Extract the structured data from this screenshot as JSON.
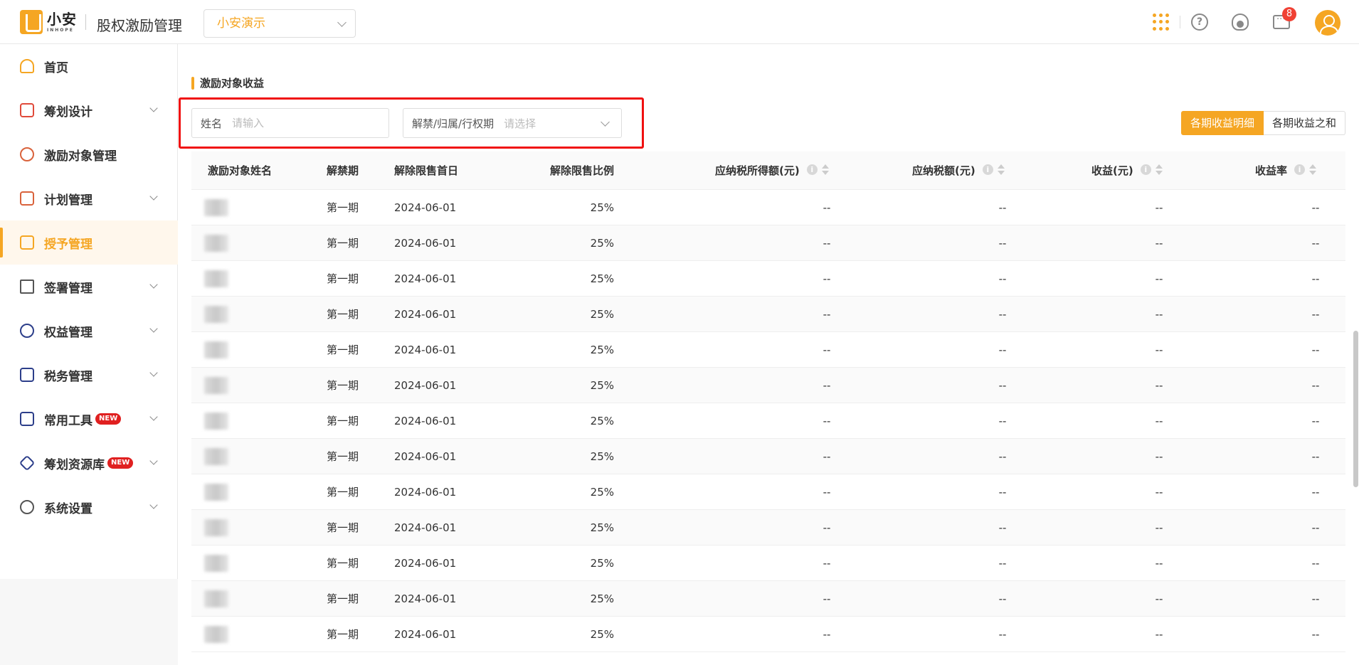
{
  "header": {
    "logo_cn": "小安",
    "logo_en": "INHOPE",
    "app_title": "股权激励管理",
    "org_select": "小安演示",
    "message_badge": "8",
    "accent_color": "#f5a623"
  },
  "sidebar": {
    "items": [
      {
        "label": "首页",
        "icon": "home-icon",
        "expandable": false
      },
      {
        "label": "筹划设计",
        "icon": "edit-icon",
        "expandable": true
      },
      {
        "label": "激励对象管理",
        "icon": "user-icon",
        "expandable": false
      },
      {
        "label": "计划管理",
        "icon": "plan-icon",
        "expandable": true
      },
      {
        "label": "授予管理",
        "icon": "grant-icon",
        "expandable": false,
        "active": true
      },
      {
        "label": "签署管理",
        "icon": "sign-icon",
        "expandable": true
      },
      {
        "label": "权益管理",
        "icon": "rights-icon",
        "expandable": true
      },
      {
        "label": "税务管理",
        "icon": "tax-icon",
        "expandable": true
      },
      {
        "label": "常用工具",
        "icon": "toolbox-icon",
        "expandable": true,
        "badge": "NEW"
      },
      {
        "label": "筹划资源库",
        "icon": "layers-icon",
        "expandable": true,
        "badge": "NEW"
      },
      {
        "label": "系统设置",
        "icon": "settings-icon",
        "expandable": true
      }
    ]
  },
  "main": {
    "section_title": "激励对象收益",
    "filters": {
      "name_label": "姓名",
      "name_placeholder": "请输入",
      "period_label": "解禁/归属/行权期",
      "period_placeholder": "请选择"
    },
    "view_toggle": {
      "option_a": "各期收益明细",
      "option_b": "各期收益之和"
    },
    "table": {
      "columns": [
        "激励对象姓名",
        "解禁期",
        "解除限售首日",
        "解除限售比例",
        "应纳税所得额(元)",
        "应纳税额(元)",
        "收益(元)",
        "收益率"
      ],
      "rows": [
        {
          "period": "第一期",
          "date": "2024-06-01",
          "ratio": "25%",
          "taxable": "--",
          "tax": "--",
          "income": "--",
          "rate": "--"
        },
        {
          "period": "第一期",
          "date": "2024-06-01",
          "ratio": "25%",
          "taxable": "--",
          "tax": "--",
          "income": "--",
          "rate": "--"
        },
        {
          "period": "第一期",
          "date": "2024-06-01",
          "ratio": "25%",
          "taxable": "--",
          "tax": "--",
          "income": "--",
          "rate": "--"
        },
        {
          "period": "第一期",
          "date": "2024-06-01",
          "ratio": "25%",
          "taxable": "--",
          "tax": "--",
          "income": "--",
          "rate": "--"
        },
        {
          "period": "第一期",
          "date": "2024-06-01",
          "ratio": "25%",
          "taxable": "--",
          "tax": "--",
          "income": "--",
          "rate": "--"
        },
        {
          "period": "第一期",
          "date": "2024-06-01",
          "ratio": "25%",
          "taxable": "--",
          "tax": "--",
          "income": "--",
          "rate": "--"
        },
        {
          "period": "第一期",
          "date": "2024-06-01",
          "ratio": "25%",
          "taxable": "--",
          "tax": "--",
          "income": "--",
          "rate": "--"
        },
        {
          "period": "第一期",
          "date": "2024-06-01",
          "ratio": "25%",
          "taxable": "--",
          "tax": "--",
          "income": "--",
          "rate": "--"
        },
        {
          "period": "第一期",
          "date": "2024-06-01",
          "ratio": "25%",
          "taxable": "--",
          "tax": "--",
          "income": "--",
          "rate": "--"
        },
        {
          "period": "第一期",
          "date": "2024-06-01",
          "ratio": "25%",
          "taxable": "--",
          "tax": "--",
          "income": "--",
          "rate": "--"
        },
        {
          "period": "第一期",
          "date": "2024-06-01",
          "ratio": "25%",
          "taxable": "--",
          "tax": "--",
          "income": "--",
          "rate": "--"
        },
        {
          "period": "第一期",
          "date": "2024-06-01",
          "ratio": "25%",
          "taxable": "--",
          "tax": "--",
          "income": "--",
          "rate": "--"
        },
        {
          "period": "第一期",
          "date": "2024-06-01",
          "ratio": "25%",
          "taxable": "--",
          "tax": "--",
          "income": "--",
          "rate": "--"
        }
      ]
    }
  }
}
